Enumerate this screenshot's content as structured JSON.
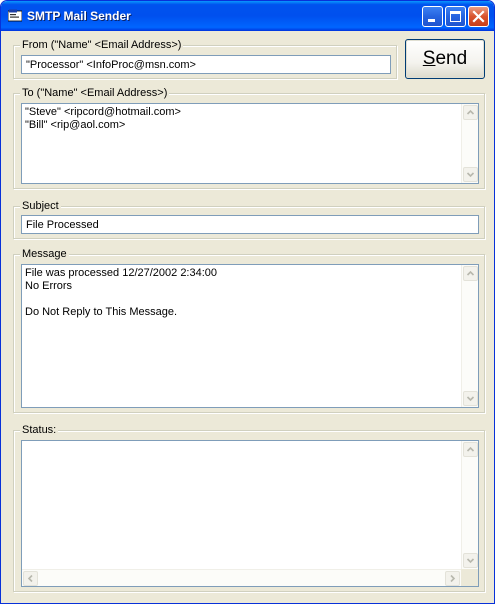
{
  "window": {
    "title": "SMTP Mail Sender",
    "controls": [
      "minimize-icon",
      "maximize-icon",
      "close-icon"
    ]
  },
  "from": {
    "label": "From (\"Name\" <Email Address>)",
    "value": "\"Processor\" <InfoProc@msn.com>"
  },
  "send_button": {
    "accel": "S",
    "rest": "end"
  },
  "to": {
    "label": "To (\"Name\" <Email Address>)",
    "lines": [
      "\"Steve\" <ripcord@hotmail.com>",
      "\"Bill\" <rip@aol.com>"
    ]
  },
  "subject": {
    "label": "Subject",
    "value": "File Processed"
  },
  "message": {
    "label": "Message",
    "lines": [
      "File was processed  12/27/2002 2:34:00",
      "No Errors",
      "",
      "Do Not Reply to This Message."
    ]
  },
  "status": {
    "label": "Status:",
    "lines": []
  },
  "colors": {
    "titlebar": "#0054e3",
    "dialog_face": "#ece9d8",
    "input_border": "#7f9db9",
    "close_button": "#d9532d"
  }
}
